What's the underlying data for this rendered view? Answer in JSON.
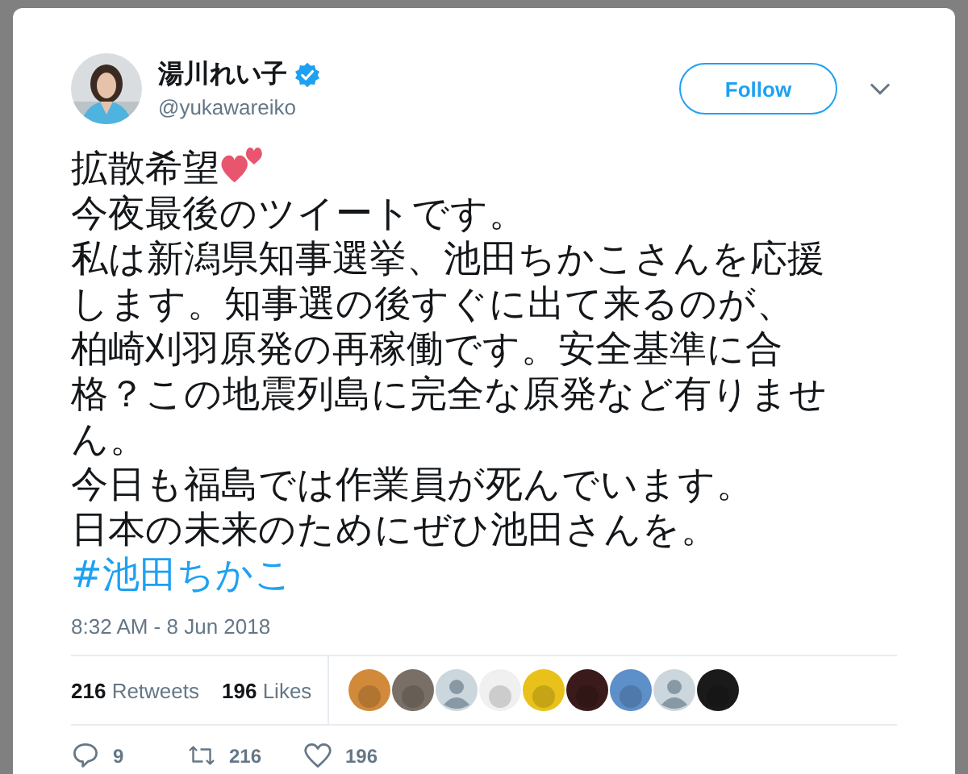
{
  "author": {
    "name": "湯川れい子",
    "verified": true,
    "handle": "@yukawareiko"
  },
  "follow_button": "Follow",
  "tweet": {
    "first_line": "拡散希望",
    "lines": [
      "今夜最後のツイートです。",
      "私は新潟県知事選挙、池田ちかこさんを応援します。知事選の後すぐに出て来るのが、柏崎刈羽原発の再稼働です。安全基準に合格？この地震列島に完全な原発など有りません。",
      "今日も福島では作業員が死んでいます。"
    ],
    "last_line": "日本の未来のためにぜひ池田さんを。",
    "hashtag": "#池田ちかこ"
  },
  "timestamp": "8:32 AM - 8 Jun 2018",
  "stats": [
    {
      "count": "216",
      "label": "Retweets"
    },
    {
      "count": "196",
      "label": "Likes"
    }
  ],
  "likers": [
    {
      "kind": "picture"
    },
    {
      "kind": "picture"
    },
    {
      "kind": "default"
    },
    {
      "kind": "picture"
    },
    {
      "kind": "picture"
    },
    {
      "kind": "picture"
    },
    {
      "kind": "picture"
    },
    {
      "kind": "default"
    },
    {
      "kind": "picture"
    }
  ],
  "actions": [
    {
      "kind": "reply",
      "count": "9"
    },
    {
      "kind": "retweet",
      "count": "216"
    },
    {
      "kind": "like",
      "count": "196"
    }
  ]
}
